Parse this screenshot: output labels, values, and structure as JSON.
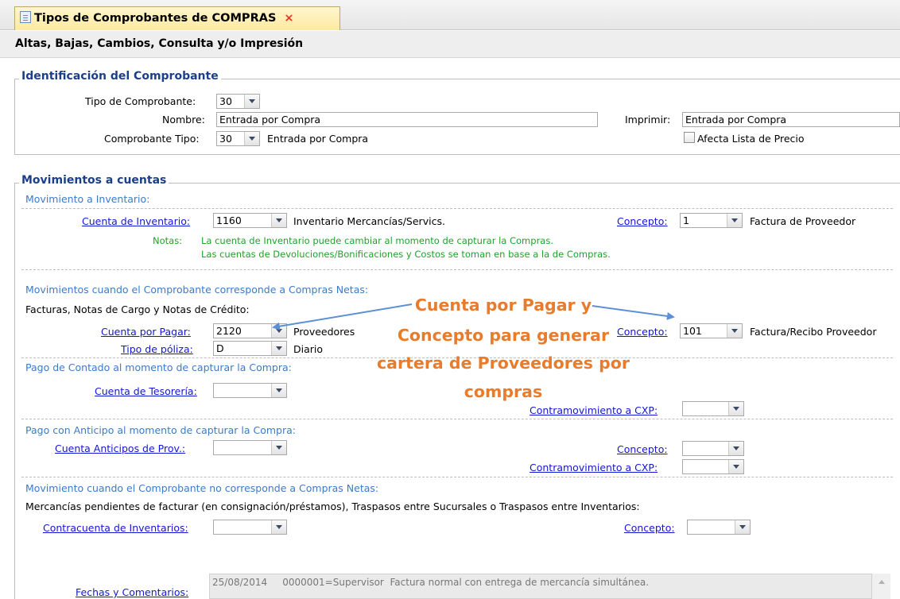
{
  "tab": {
    "title": "Tipos de Comprobantes de COMPRAS",
    "close_glyph": "×"
  },
  "subtitle": "Altas, Bajas, Cambios, Consulta y/o Impresión",
  "identificacion": {
    "legend": "Identificación del Comprobante",
    "tipo_label": "Tipo de Comprobante:",
    "tipo_value": "30",
    "nombre_label": "Nombre:",
    "nombre_value": "Entrada por Compra",
    "imprimir_label": "Imprimir:",
    "imprimir_value": "Entrada por Compra",
    "comp_tipo_label": "Comprobante Tipo:",
    "comp_tipo_value": "30",
    "comp_tipo_desc": "Entrada por Compra",
    "afecta_label": "Afecta Lista de Precio"
  },
  "movimientos": {
    "legend": "Movimientos a cuentas",
    "inventario": {
      "heading": "Movimiento a Inventario:",
      "cuenta_label": "Cuenta de Inventario:",
      "cuenta_value": "1160",
      "cuenta_desc": "Inventario Mercancías/Servics.",
      "concepto_label": "Concepto:",
      "concepto_value": "1",
      "concepto_desc": "Factura de Proveedor",
      "notas_label": "Notas:",
      "nota1": "La cuenta de Inventario puede cambiar al momento de capturar la Compras.",
      "nota2": "Las cuentas de Devoluciones/Bonificaciones y Costos se toman en base a la de Compras."
    },
    "netas": {
      "heading": "Movimientos cuando el Comprobante corresponde a Compras Netas:",
      "sub": "Facturas, Notas de Cargo y Notas de Crédito:",
      "cxp_label": "Cuenta por Pagar:",
      "cxp_value": "2120",
      "cxp_desc": "Proveedores",
      "concepto_label": "Concepto:",
      "concepto_value": "101",
      "concepto_desc": "Factura/Recibo Proveedor",
      "poliza_label": "Tipo de póliza:",
      "poliza_value": "D",
      "poliza_desc": "Diario"
    },
    "contado": {
      "heading": "Pago de Contado al momento de capturar la Compra:",
      "tesoreria_label": "Cuenta de Tesorería:",
      "tesoreria_value": "",
      "contra_label": "Contramovimiento a CXP:",
      "contra_value": ""
    },
    "anticipo": {
      "heading": "Pago con Anticipo al momento de capturar la Compra:",
      "anticipos_label": "Cuenta Anticipos de Prov.:",
      "anticipos_value": "",
      "concepto_label": "Concepto:",
      "concepto_value": "",
      "contra_label": "Contramovimiento a CXP:",
      "contra_value": ""
    },
    "no_netas": {
      "heading": "Movimiento cuando el Comprobante no corresponde a Compras Netas:",
      "sub": "Mercancías pendientes de facturar (en consignación/préstamos), Traspasos entre Sucursales o Traspasos entre Inventarios:",
      "contracuenta_label": "Contracuenta de Inventarios:",
      "contracuenta_value": "",
      "concepto_label": "Concepto:",
      "concepto_value": ""
    },
    "fechas": {
      "label": "Fechas y Comentarios:",
      "value": "25/08/2014     0000001=Supervisor  Factura normal con entrega de mercancía simultánea."
    }
  },
  "callout": {
    "line1": "Cuenta por Pagar  y",
    "line2": "Concepto para generar",
    "line3": "cartera de Proveedores por",
    "line4": "compras",
    "color": "#e87c2c",
    "arrow_color": "#5b8fd6"
  }
}
